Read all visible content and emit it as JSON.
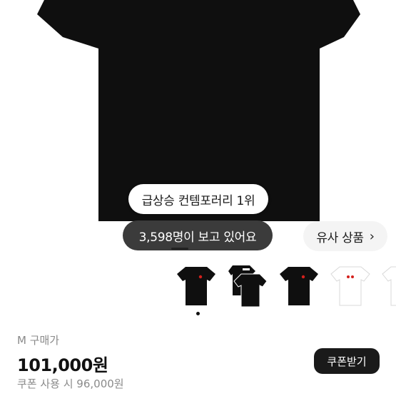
{
  "rank_badge": "급상승 컨템포러리 1위",
  "viewers_badge": "3,598명이 보고 있어요",
  "similar_products": {
    "label": "유사 상품",
    "icon": "chevron-right-icon",
    "chevron": "›"
  },
  "thumbnails": [
    {
      "name": "black-tshirt-red-heart",
      "color": "#0f0f0f"
    },
    {
      "name": "black-tshirt-pack",
      "color": "#0f0f0f"
    },
    {
      "name": "black-tshirt-red-heart-2",
      "color": "#0f0f0f"
    },
    {
      "name": "white-tshirt-red-heart",
      "color": "#ffffff"
    },
    {
      "name": "white-tshirt-partial",
      "color": "#ffffff"
    }
  ],
  "pricing": {
    "label": "M 구매가",
    "price": "101,000원",
    "coupon_price": "쿠폰 사용 시 96,000원"
  },
  "coupon_button": "쿠폰받기",
  "colors": {
    "shirt": "#0f0f0f",
    "viewers_bg": "#3b3b3b",
    "coupon_btn": "#1a1a1a"
  }
}
